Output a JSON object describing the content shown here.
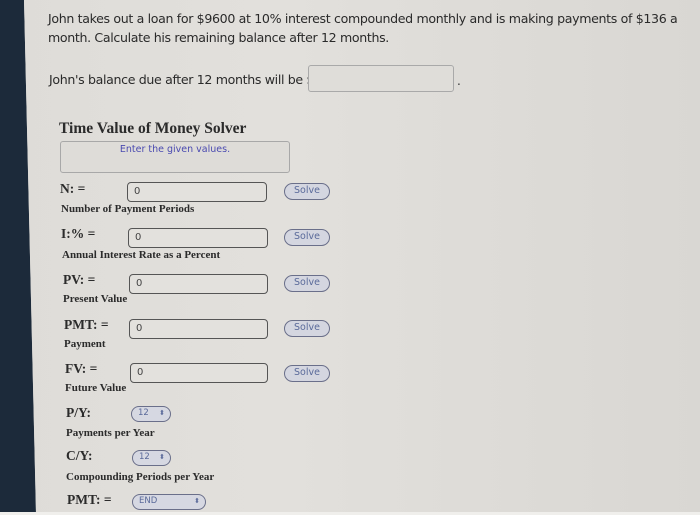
{
  "question": {
    "text": "John takes out a loan for $9600 at 10% interest compounded monthly and is making payments of $136 a month. Calculate his remaining balance after 12 months.",
    "answer_prefix": "John's balance due after 12 months will be $",
    "answer_value": "",
    "answer_suffix": "."
  },
  "solver": {
    "title": "Time Value of Money Solver",
    "message": "Enter the given values.",
    "solve_label": "Solve",
    "fields": [
      {
        "key": "N",
        "label": "N: =",
        "description": "Number of Payment Periods",
        "value": "0"
      },
      {
        "key": "I",
        "label": "I:% =",
        "description": "Annual Interest Rate as a Percent",
        "value": "0"
      },
      {
        "key": "PV",
        "label": "PV: =",
        "description": "Present Value",
        "value": "0"
      },
      {
        "key": "PMT",
        "label": "PMT: =",
        "description": "Payment",
        "value": "0"
      },
      {
        "key": "FV",
        "label": "FV: =",
        "description": "Future Value",
        "value": "0"
      }
    ],
    "py": {
      "label": "P/Y:",
      "description": "Payments per Year",
      "value": "12"
    },
    "cy": {
      "label": "C/Y:",
      "description": "Compounding Periods per Year",
      "value": "12"
    },
    "pmt_timing": {
      "label": "PMT: =",
      "value": "END"
    },
    "select_arrow_icon": "⬍"
  }
}
